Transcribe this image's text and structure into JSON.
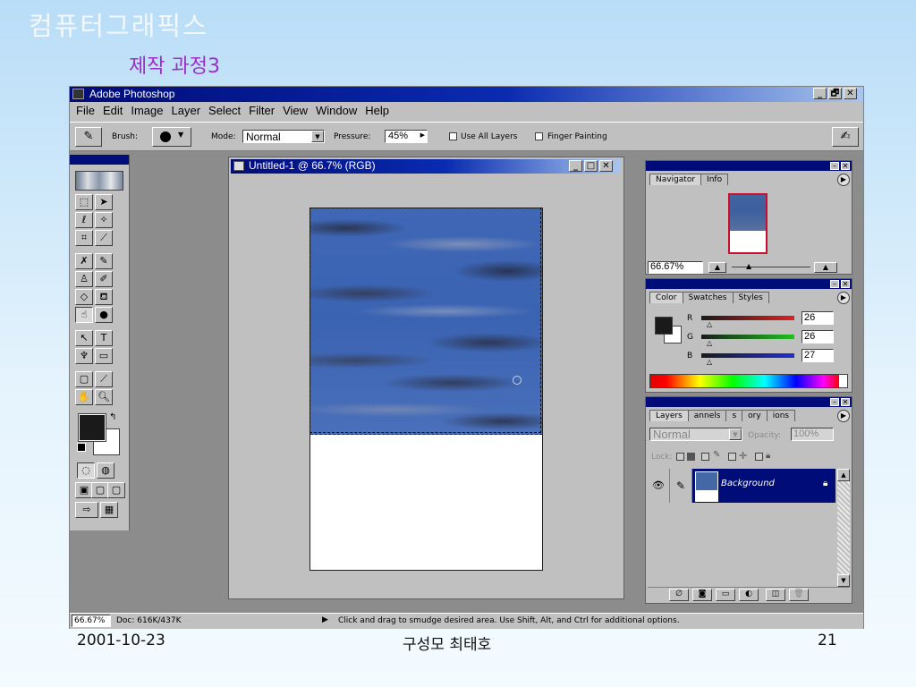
{
  "slide": {
    "title": "컴퓨터그래픽스",
    "subtitle": "제작 과정3",
    "date": "2001-10-23",
    "author": "구성모 최태호",
    "page": "21"
  },
  "app": {
    "title": "Adobe Photoshop",
    "window_buttons": [
      "_",
      "🗗",
      "✕"
    ]
  },
  "menu": [
    "File",
    "Edit",
    "Image",
    "Layer",
    "Select",
    "Filter",
    "View",
    "Window",
    "Help"
  ],
  "options": {
    "brush_label": "Brush:",
    "mode_label": "Mode:",
    "mode_value": "Normal",
    "pressure_label": "Pressure:",
    "pressure_value": "45%",
    "use_all_layers": "Use All Layers",
    "finger_painting": "Finger Painting"
  },
  "document": {
    "title": "Untitled-1 @ 66.7% (RGB)"
  },
  "navigator": {
    "tabs": [
      "Navigator",
      "Info"
    ],
    "zoom": "66.67%"
  },
  "color": {
    "tabs": [
      "Color",
      "Swatches",
      "Styles"
    ],
    "r_label": "R",
    "r_value": "26",
    "g_label": "G",
    "g_value": "26",
    "b_label": "B",
    "b_value": "27"
  },
  "layers": {
    "tabs": [
      "Layers",
      "annels",
      "s",
      "ory",
      "ions"
    ],
    "blend_mode": "Normal",
    "opacity_label": "Opacity:",
    "opacity_value": "100%",
    "lock_label": "Lock:",
    "layer_name": "Background"
  },
  "status": {
    "zoom": "66.67%",
    "doc": "Doc: 616K/437K",
    "hint": "Click and drag to smudge desired area.  Use Shift, Alt, and Ctrl for additional options."
  }
}
